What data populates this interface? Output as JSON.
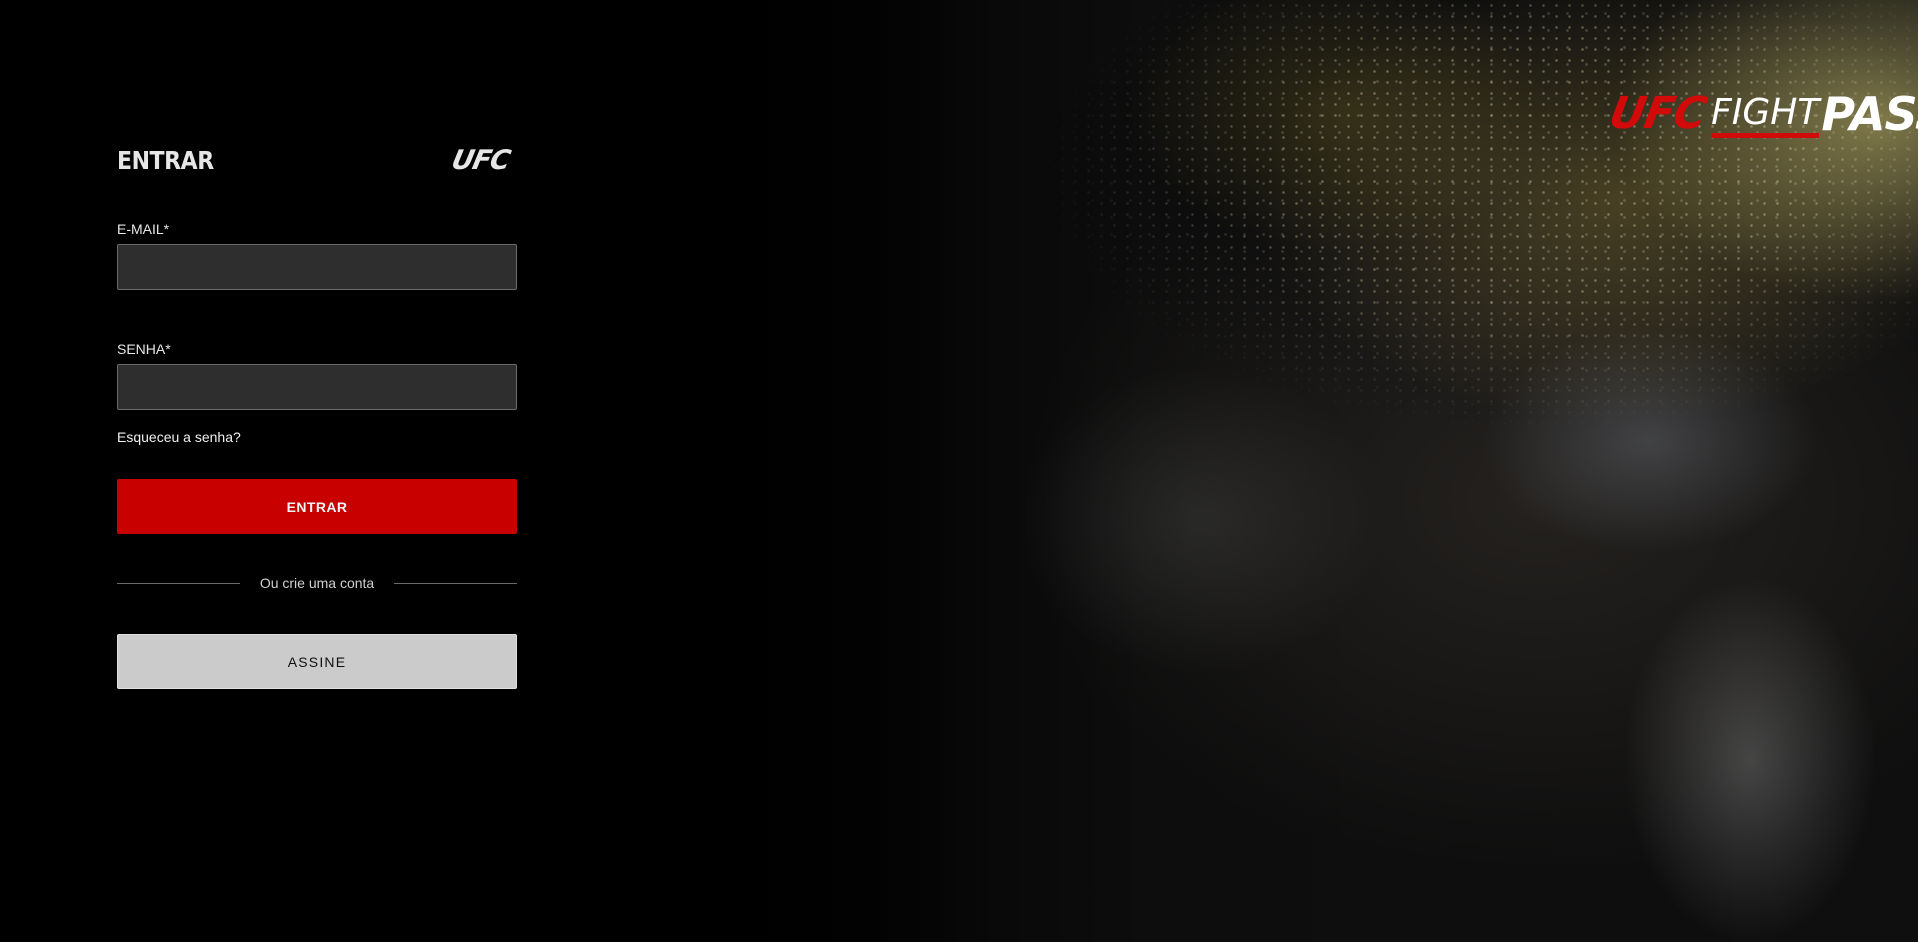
{
  "brand": {
    "fight_pass_logo": {
      "part_ufc": "UFC",
      "part_fight": "FIGHT",
      "part_pass": "PASS"
    },
    "ufc_logo": "UFC",
    "accent_color": "#c80000"
  },
  "login": {
    "title": "ENTRAR",
    "email": {
      "label": "E-MAIL*",
      "value": "",
      "placeholder": ""
    },
    "password": {
      "label": "SENHA*",
      "value": "",
      "placeholder": ""
    },
    "forgot_password": "Esqueceu a senha?",
    "submit_label": "ENTRAR",
    "divider_text": "Ou crie uma conta",
    "subscribe_label": "ASSINE"
  }
}
